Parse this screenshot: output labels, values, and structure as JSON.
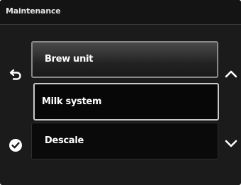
{
  "header": {
    "title": "Maintenance"
  },
  "menu": {
    "items": [
      {
        "label": "Brew unit"
      },
      {
        "label": "Milk system"
      },
      {
        "label": "Descale"
      }
    ],
    "selected_index": 1
  },
  "controls": {
    "back_icon": "back-arrow-icon",
    "confirm_icon": "checkmark-icon",
    "scroll_up_icon": "chevron-up-icon",
    "scroll_down_icon": "chevron-down-icon"
  },
  "colors": {
    "background": "#1b1b1b",
    "text": "#ffffff",
    "selected_border": "#c9c9c9"
  }
}
